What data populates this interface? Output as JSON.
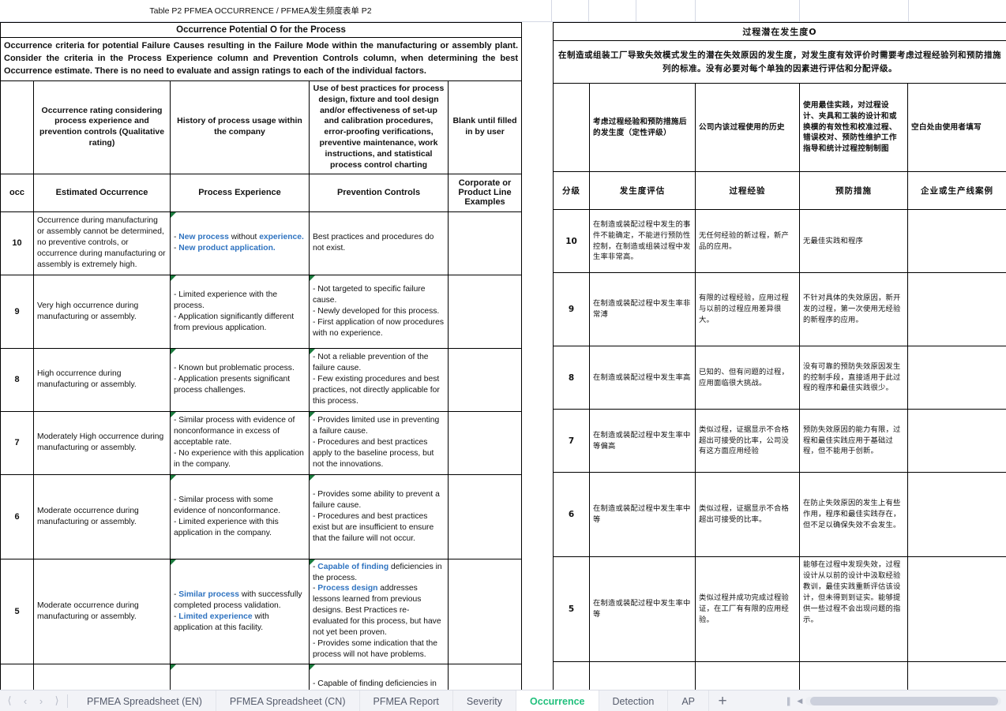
{
  "document": {
    "title": "Table P2 PFMEA OCCURRENCE  / PFMEA发生频度表单 P2"
  },
  "colors": {
    "header_blue": "#95afd8",
    "accent_link": "#2f73c0",
    "active_tab_green": "#22c07d",
    "comment_marker_green": "#1a7a3c"
  },
  "en_table": {
    "banner": "Occurrence Potential O for the Process",
    "criteria": "Occurrence criteria for potential Failure Causes resulting in the Failure Mode within the manufacturing or assembly plant. Consider the criteria in the Process Experience column and Prevention Controls column, when determining the best Occurrence estimate. There is no need to evaluate and assign ratings to each of the individual factors.",
    "desc_headers": [
      "",
      "Occurrence rating considering process experience and prevention controls (Qualitative rating)",
      "History of process usage within the company",
      "Use of best practices for process design, fixture and tool design and/or effectiveness of set-up and calibration procedures, error-proofing verifications, preventive maintenance, work instructions, and statistical process control charting",
      "Blank until filled in by user"
    ],
    "col_headers": [
      "occ",
      "Estimated Occurrence",
      "Process Experience",
      "Prevention Controls",
      "Corporate or Product Line Examples"
    ],
    "rows": [
      {
        "occ": "10",
        "estimated": "Occurrence during manufacturing or assembly cannot be determined, no preventive controls, or occurrence during manufacturing or assembly is extremely high.",
        "experience_parts": [
          {
            "text": "- ",
            "link": false
          },
          {
            "text": "New process",
            "link": true
          },
          {
            "text": " without experience.",
            "link": false
          },
          {
            "text": "\n- ",
            "link": false
          },
          {
            "text": "New product application.",
            "link": true
          }
        ],
        "experience_plain": "- New process without experience.\n- New product application.",
        "prevention": "Best practices and procedures do not exist.",
        "examples": ""
      },
      {
        "occ": "9",
        "estimated": "Very high occurrence during manufacturing or assembly.",
        "experience_plain": "- Limited experience with the process.\n- Application significantly different from previous application.",
        "prevention": "- Not targeted to specific failure cause.\n- Newly developed for this process.\n- First application of now procedures with no experience.",
        "examples": ""
      },
      {
        "occ": "8",
        "estimated": "High occurrence during manufacturing or assembly.",
        "experience_plain": "- Known but problematic process.\n- Application presents significant process challenges.",
        "prevention": "- Not a reliable prevention of the failure cause.\n- Few existing procedures and best practices, not directly applicable for this process.",
        "examples": ""
      },
      {
        "occ": "7",
        "estimated": "Moderately High occurrence during manufacturing or assembly.",
        "experience_plain": "- Similar process with evidence of nonconformance in excess of acceptable rate.\n- No experience with this application in the company.",
        "prevention": "- Provides limited use in preventing a failure cause.\n- Procedures and best practices apply to the baseline process, but not the innovations.",
        "examples": ""
      },
      {
        "occ": "6",
        "estimated": "Moderate occurrence during manufacturing or assembly.",
        "experience_plain": "- Similar process with some evidence of nonconformance.\n- Limited experience with this application in the company.",
        "prevention": "- Provides some ability to prevent a failure cause.\n- Procedures and best practices exist but are insufficient to ensure that the failure will not occur.",
        "examples": ""
      },
      {
        "occ": "5",
        "estimated": "Moderate occurrence during manufacturing or assembly.",
        "experience_plain": "- Similar process with successfully completed process validation.\n- Limited experience with application at this facility.",
        "prevention": "- Capable of finding deficiencies in the process.\n- Process design addresses lessons learned from previous designs. Best Practices re-evaluated for this process, but have not yet been proven.\n- Provides some indication that the process will not have problems.",
        "examples": ""
      }
    ],
    "partial_row": {
      "prevention": "- Capable of finding deficiencies in"
    }
  },
  "cn_table": {
    "banner": "过程潜在发生度O",
    "criteria": "在制造或组装工厂导致失效模式发生的潜在失效原因的发生度，对发生度有效评价时需要考虑过程经验列和预防措施列的标准。没有必要对每个单独的因素进行评估和分配评级。",
    "desc_headers": [
      "",
      "考虑过程经验和预防措施后的发生度（定性评级）",
      "公司内该过程使用的历史",
      "使用最佳实践，对过程设计、夹具和工装的设计和或换模的有效性和校准过程、错误校对、预防性维护工作指导和统计过程控制制图",
      "空白处由使用者填写"
    ],
    "col_headers": [
      "分级",
      "发生度评估",
      "过程经验",
      "预防措施",
      "企业或生产线案例"
    ],
    "rows": [
      {
        "occ": "10",
        "estimated": "在制造或装配过程中发生的事件不能确定，不能进行预防性控制，在制造或组装过程中发生率非常高。",
        "experience": "无任何经验的新过程，新产品的应用。",
        "prevention": "无最佳实践和程序",
        "examples": ""
      },
      {
        "occ": "9",
        "estimated": "在制造或装配过程中发生率非常溥",
        "experience": "有限的过程经验，应用过程与以前的过程应用差异很大。",
        "prevention": "不针对具体的失效原因，新开发的过程，第一次使用无经验的新程序的应用。",
        "examples": ""
      },
      {
        "occ": "8",
        "estimated": "在制造或装配过程中发生率高",
        "experience": "已知的、但有问题的过程，应用面临很大挑战。",
        "prevention": "没有可靠的预防失效原因发生的控制手段，直接适用于此过程的程序和最佳实践很少。",
        "examples": ""
      },
      {
        "occ": "7",
        "estimated": "在制造或装配过程中发生率中等偏高",
        "experience": "类似过程，证据显示不合格超出可接受的比率，公司没有这方面应用经验",
        "prevention": "预防失效原因的能力有限，过程和最佳实践应用于基础过程，但不能用于创新。",
        "examples": ""
      },
      {
        "occ": "6",
        "estimated": "在制造或装配过程中发生率中等",
        "experience": "类似过程，证据显示不合格超出可接受的比率。",
        "prevention": "在防止失效原因的发生上有些作用，程序和最佳实践存在，但不足以确保失效不会发生。",
        "examples": ""
      },
      {
        "occ": "5",
        "estimated": "在制造或装配过程中发生率中等",
        "experience": "类似过程并成功完成过程验证，在工厂有有限的应用经验。",
        "prevention": "能够在过程中发现失效，过程设计从以前的设计中汲取经验教训，最佳实践重新评估该设计，但未得到到证实。能够提供一些过程不会出现问题的指示。",
        "examples": ""
      }
    ]
  },
  "tabbar": {
    "nav": [
      {
        "name": "first-sheet",
        "glyph": "⟨"
      },
      {
        "name": "prev-sheet",
        "glyph": "‹"
      },
      {
        "name": "next-sheet",
        "glyph": "›"
      },
      {
        "name": "last-sheet",
        "glyph": "⟩"
      }
    ],
    "tabs": [
      {
        "label": "PFMEA Spreadsheet (EN)",
        "active": false
      },
      {
        "label": "PFMEA Spreadsheet (CN)",
        "active": false
      },
      {
        "label": "PFMEA Report",
        "active": false
      },
      {
        "label": "Severity",
        "active": false
      },
      {
        "label": "Occurrence",
        "active": true
      },
      {
        "label": "Detection",
        "active": false
      },
      {
        "label": "AP",
        "active": false
      }
    ],
    "add_label": "+"
  }
}
